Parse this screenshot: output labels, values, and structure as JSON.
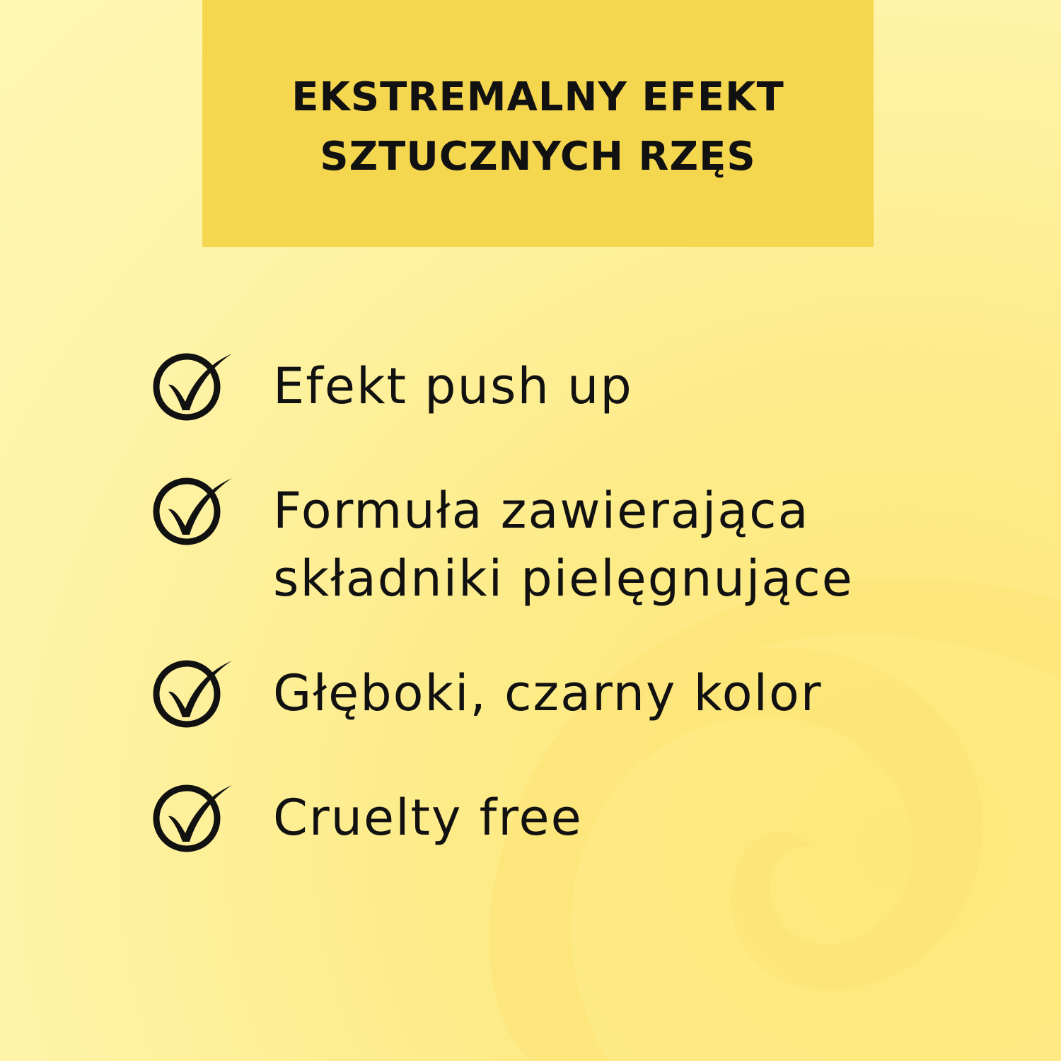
{
  "header": {
    "line1": "EKSTREMALNY EFEKT",
    "line2": "SZTUCZNYCH RZĘS",
    "background_color": "#f5d64f"
  },
  "features": [
    {
      "icon": "check-circle-icon",
      "lines": [
        "Efekt push up"
      ]
    },
    {
      "icon": "check-circle-icon",
      "lines": [
        "Formuła zawierająca",
        "składniki pielęgnujące"
      ]
    },
    {
      "icon": "check-circle-icon",
      "lines": [
        "Głęboki, czarny kolor"
      ]
    },
    {
      "icon": "check-circle-icon",
      "lines": [
        "Cruelty free"
      ]
    }
  ],
  "colors": {
    "background": "#fef0a0",
    "swirl": "#fde275",
    "text": "#111111"
  }
}
